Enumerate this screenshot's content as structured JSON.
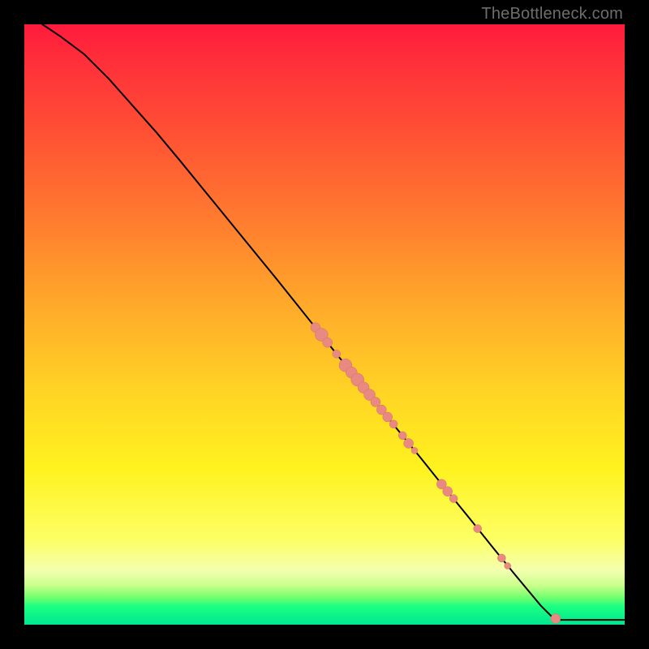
{
  "watermark": "TheBottleneck.com",
  "colors": {
    "page_bg": "#000000",
    "curve_stroke": "#000000",
    "point_fill": "#e98a82",
    "point_stroke": "#d86d64"
  },
  "chart_data": {
    "type": "line",
    "title": "",
    "xlabel": "",
    "ylabel": "",
    "xlim": [
      0,
      100
    ],
    "ylim": [
      0,
      100
    ],
    "grid": false,
    "curve_points": [
      {
        "x": 3,
        "y": 100
      },
      {
        "x": 6,
        "y": 98
      },
      {
        "x": 10,
        "y": 95
      },
      {
        "x": 14,
        "y": 91
      },
      {
        "x": 18,
        "y": 86.5
      },
      {
        "x": 22,
        "y": 82
      },
      {
        "x": 26,
        "y": 77.2
      },
      {
        "x": 30,
        "y": 72.3
      },
      {
        "x": 34,
        "y": 67.4
      },
      {
        "x": 38,
        "y": 62.5
      },
      {
        "x": 42,
        "y": 57.6
      },
      {
        "x": 46,
        "y": 52.6
      },
      {
        "x": 50,
        "y": 47.6
      },
      {
        "x": 54,
        "y": 42.6
      },
      {
        "x": 58,
        "y": 37.7
      },
      {
        "x": 62,
        "y": 32.7
      },
      {
        "x": 66,
        "y": 27.8
      },
      {
        "x": 70,
        "y": 22.8
      },
      {
        "x": 74,
        "y": 17.9
      },
      {
        "x": 78,
        "y": 12.9
      },
      {
        "x": 82,
        "y": 8
      },
      {
        "x": 86,
        "y": 3.2
      },
      {
        "x": 88,
        "y": 1.2
      },
      {
        "x": 89,
        "y": 0.8
      },
      {
        "x": 100,
        "y": 0.8
      }
    ],
    "series": [
      {
        "name": "highlighted-points",
        "points": [
          {
            "x": 48.5,
            "y": 49.5,
            "r": 6
          },
          {
            "x": 49.5,
            "y": 48.3,
            "r": 8
          },
          {
            "x": 50.5,
            "y": 47.0,
            "r": 6
          },
          {
            "x": 52.0,
            "y": 45.1,
            "r": 5
          },
          {
            "x": 53.5,
            "y": 43.2,
            "r": 8
          },
          {
            "x": 54.5,
            "y": 42.0,
            "r": 7
          },
          {
            "x": 55.5,
            "y": 40.8,
            "r": 8
          },
          {
            "x": 56.5,
            "y": 39.5,
            "r": 7
          },
          {
            "x": 57.5,
            "y": 38.3,
            "r": 7
          },
          {
            "x": 58.5,
            "y": 37.1,
            "r": 6
          },
          {
            "x": 59.5,
            "y": 35.8,
            "r": 6
          },
          {
            "x": 60.5,
            "y": 34.6,
            "r": 6
          },
          {
            "x": 61.5,
            "y": 33.4,
            "r": 5
          },
          {
            "x": 63.0,
            "y": 31.5,
            "r": 5
          },
          {
            "x": 64.0,
            "y": 30.2,
            "r": 6
          },
          {
            "x": 65.0,
            "y": 29.0,
            "r": 4
          },
          {
            "x": 69.5,
            "y": 23.4,
            "r": 6
          },
          {
            "x": 70.5,
            "y": 22.2,
            "r": 6
          },
          {
            "x": 71.5,
            "y": 21.0,
            "r": 5
          },
          {
            "x": 75.5,
            "y": 16.0,
            "r": 5
          },
          {
            "x": 79.5,
            "y": 11.1,
            "r": 5
          },
          {
            "x": 80.5,
            "y": 9.8,
            "r": 4
          },
          {
            "x": 88.5,
            "y": 1.0,
            "r": 6
          }
        ]
      }
    ]
  }
}
